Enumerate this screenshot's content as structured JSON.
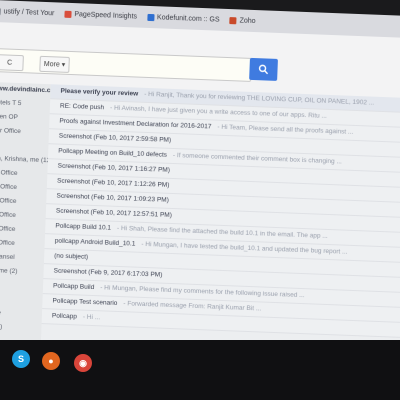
{
  "bookmarks": [
    {
      "label": "ustify / Test Your",
      "color": "#6a6f7a"
    },
    {
      "label": "PageSpeed Insights",
      "color": "#d94e3c"
    },
    {
      "label": "Kodefunit.com :: GS",
      "color": "#2f6fd0"
    },
    {
      "label": "Zoho",
      "color": "#c94a2a"
    }
  ],
  "toolbar": {
    "refresh_label": "C",
    "more_label": "More ▾",
    "search_icon": "magnifier-icon"
  },
  "sidebar": {
    "items": [
      "www.devindiainc.com",
      "Hotels T 5",
      "Hiten OP",
      "Ipur Office",
      "",
      "hah, Krishna, me (12)",
      "pur Office",
      "pur Office",
      "pur Office",
      "pur Office",
      "pur Office",
      "pur Office",
      "tel Kansel",
      "Xin, me (2)",
      "ar",
      "me",
      "Office",
      "me (2)"
    ]
  },
  "mail": {
    "rows": [
      {
        "subject": "Please verify your review",
        "snippet": "- Hi Ranjit, Thank you for reviewing THE LOVING CUP, OIL ON PANEL, 1902 ..."
      },
      {
        "subject": "RE: Code push",
        "snippet": "- Hi Avinash, I have just given you a write access to one of our apps. Ritu ..."
      },
      {
        "subject": "Proofs against Investment Declaration for 2016-2017",
        "snippet": "- Hi Team, Please send all the proofs against ..."
      },
      {
        "subject": "Screenshot (Feb 10, 2017 2:59:58 PM)",
        "snippet": ""
      },
      {
        "subject": "Pollcapp Meeting on Build_10 defects",
        "snippet": "- If someone commented their comment box is changing ..."
      },
      {
        "subject": "Screenshot (Feb 10, 2017 1:16:27 PM)",
        "snippet": ""
      },
      {
        "subject": "Screenshot (Feb 10, 2017 1:12:26 PM)",
        "snippet": ""
      },
      {
        "subject": "Screenshot (Feb 10, 2017 1:09:23 PM)",
        "snippet": ""
      },
      {
        "subject": "Screenshot (Feb 10, 2017 12:57:51 PM)",
        "snippet": ""
      },
      {
        "subject": "Pollcapp Build 10.1",
        "snippet": "- Hi Shah, Please find the attached the build 10.1 in the email. The app ..."
      },
      {
        "subject": "pollcapp Android Build_10.1",
        "snippet": "- Hi Mungan, I have tested the build_10.1 and updated the bug report ..."
      },
      {
        "subject": "(no subject)",
        "snippet": ""
      },
      {
        "subject": "Screenshot (Feb 9, 2017 6:17:03 PM)",
        "snippet": ""
      },
      {
        "subject": "Pollcapp Build",
        "snippet": "- Hi Mungan, Please find my comments for the following issue raised ..."
      },
      {
        "subject": "Pollcapp Test scenario",
        "snippet": "- Forwarded message From: Ranjit Kumar Bit ..."
      },
      {
        "subject": "Pollcapp",
        "snippet": "- Hi ..."
      }
    ]
  },
  "taskbar": {
    "icons": [
      {
        "name": "skype-icon",
        "glyph": "S",
        "color": "#1e9fe0"
      },
      {
        "name": "firefox-icon",
        "glyph": "●",
        "color": "#e1661f"
      },
      {
        "name": "chrome-icon",
        "glyph": "◉",
        "color": "#d9453a"
      }
    ]
  }
}
